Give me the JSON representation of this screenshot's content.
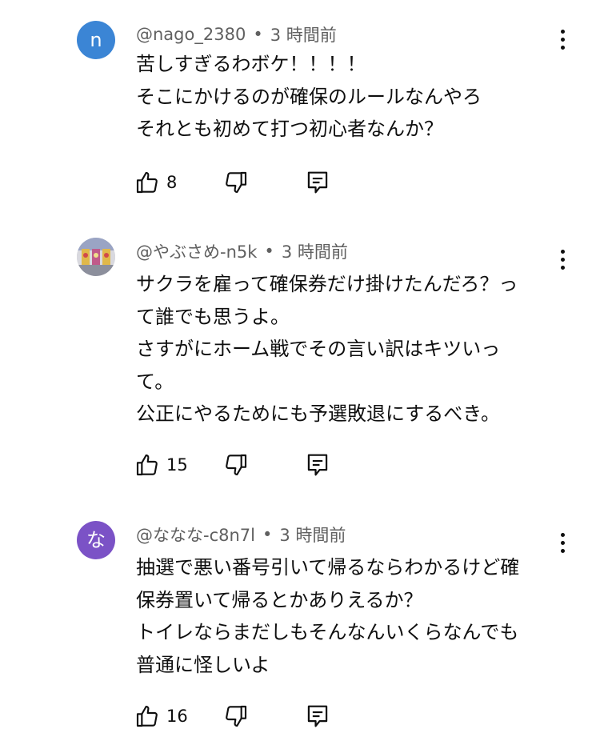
{
  "comments": [
    {
      "avatar_letter": "n",
      "avatar_color": "#3b85d5",
      "handle": "@nago_2380",
      "separator": "•",
      "time": "3 時間前",
      "lines": [
        "苦しすぎるわボケ！！！！",
        "そこにかけるのが確保のルールなんやろ",
        "それとも初めて打つ初心者なんか？"
      ],
      "likes": "8"
    },
    {
      "avatar_letter": "",
      "avatar_color": "#c9cbd2",
      "handle": "@やぶさめ-n5k",
      "separator": "•",
      "time": "3 時間前",
      "lines": [
        "サクラを雇って確保券だけ掛けたんだろ？っ",
        "て誰でも思うよ。",
        "さすがにホーム戦でその言い訳はキツいっ",
        "て。",
        "公正にやるためにも予選敗退にするべき。"
      ],
      "likes": "15"
    },
    {
      "avatar_letter": "な",
      "avatar_color": "#7b52c6",
      "handle": "@ななな-c8n7l",
      "separator": "•",
      "time": "3 時間前",
      "lines": [
        "抽選で悪い番号引いて帰るならわかるけど確",
        "保券置いて帰るとかありえるか？",
        "トイレならまだしもそんなんいくらなんでも",
        "普通に怪しいよ"
      ],
      "likes": "16"
    }
  ],
  "icons": {
    "like": "thumb-up-icon",
    "dislike": "thumb-down-icon",
    "reply": "reply-comment-icon",
    "more": "more-vertical-icon"
  }
}
